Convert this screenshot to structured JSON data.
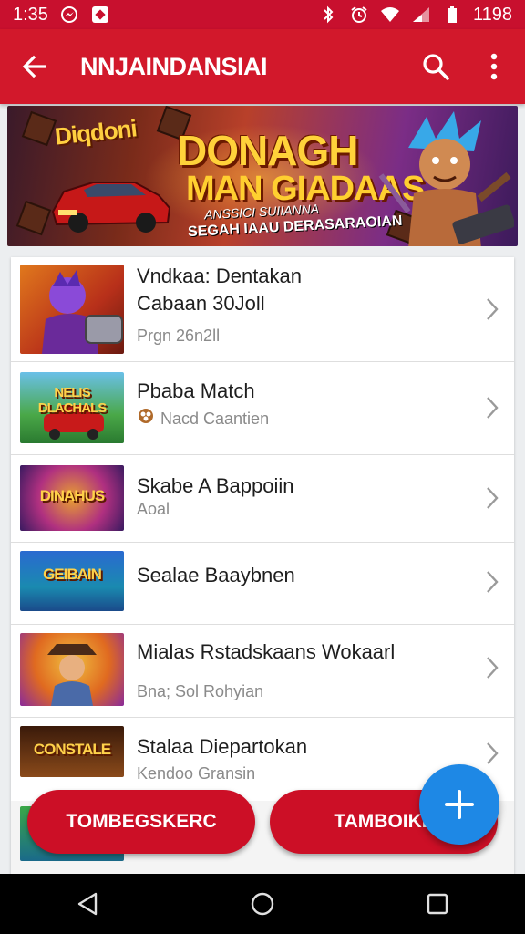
{
  "status_bar": {
    "time": "1:35",
    "battery_text": "1198",
    "icons": [
      "messenger-icon",
      "app-icon",
      "bluetooth-icon",
      "alarm-icon",
      "wifi-icon",
      "signal-icon",
      "battery-icon"
    ]
  },
  "app_bar": {
    "title": "NNJAINDANSIAI",
    "icons": [
      "back-arrow-icon",
      "search-icon",
      "more-vert-icon"
    ]
  },
  "banner": {
    "tag": "Diqdoni",
    "headline_1": "DONAGH",
    "headline_2": "MAN GIADAAS",
    "sub_1": "ANSSICI SUIIANNA",
    "sub_2": "SEGAH IAAU DERASARAOIAN"
  },
  "list": {
    "items": [
      {
        "title_line1": "Vndkaa: Dentakan",
        "title_line2": "Cabaan 30Joll",
        "subtitle": "Prgn 26n2ll",
        "subtitle_icon": "",
        "thumb_label": ""
      },
      {
        "title_line1": "Pbaba Match",
        "title_line2": "",
        "subtitle": "Nacd Caantien",
        "subtitle_icon": "pretzel-icon",
        "thumb_label": "NELIS DLACHALS"
      },
      {
        "title_line1": "Skabe A Bappoiin",
        "title_line2": "",
        "subtitle": "Aoal",
        "subtitle_icon": "",
        "thumb_label": "DINAHUS"
      },
      {
        "title_line1": "Sealae Baaybnen",
        "title_line2": "",
        "subtitle": "",
        "subtitle_icon": "",
        "thumb_label": "GEIBAIN"
      },
      {
        "title_line1": "Mialas Rstadskaans Wokaarl",
        "title_line2": "",
        "subtitle": "Bna; Sol Rohyian",
        "subtitle_icon": "",
        "thumb_label": ""
      },
      {
        "title_line1": "Stalaa Diepartokan",
        "title_line2": "",
        "subtitle": "Kendoo Gransin",
        "subtitle_icon": "",
        "thumb_label": "CONSTALE"
      }
    ]
  },
  "buttons": {
    "left_label": "TOMBEGSKERC",
    "right_label": "TAMBOIKL"
  },
  "fab": {
    "icon": "plus-icon"
  },
  "nav_bar": {
    "icons": [
      "back-triangle-icon",
      "home-circle-icon",
      "recents-square-icon"
    ]
  },
  "colors": {
    "primary": "#d2182b",
    "status": "#c8102e",
    "fab": "#1e88e5",
    "button": "#cc0f26"
  }
}
